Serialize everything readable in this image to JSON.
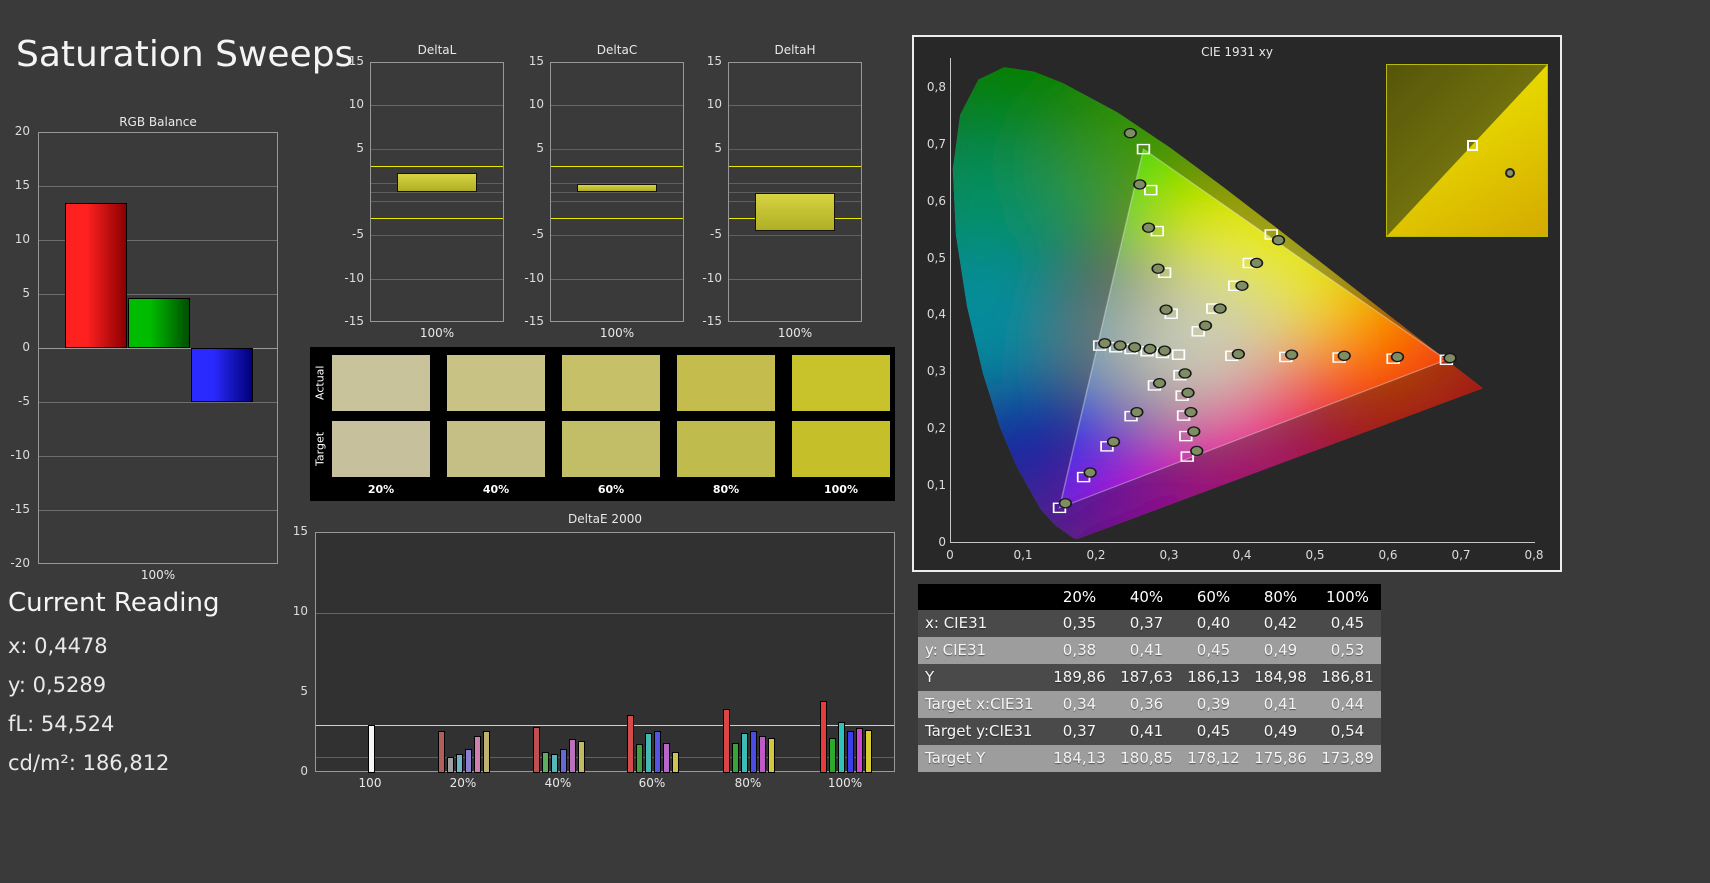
{
  "page": {
    "title": "Saturation Sweeps"
  },
  "current_reading": {
    "heading": "Current Reading",
    "lines": [
      "x: 0,4478",
      "y: 0,5289",
      "fL: 54,524",
      "cd/m²: 186,812"
    ]
  },
  "swatches": {
    "row_labels": [
      "Actual",
      "Target"
    ],
    "col_labels": [
      "20%",
      "40%",
      "60%",
      "80%",
      "100%"
    ],
    "actual_colors": [
      "#c9c39c",
      "#c8c384",
      "#c6c069",
      "#c4bd4d",
      "#c8c22b"
    ],
    "target_colors": [
      "#c6c09d",
      "#c5bf85",
      "#c2be68",
      "#c0bb4d",
      "#c5bf2a"
    ]
  },
  "table": {
    "headers": [
      "",
      "20%",
      "40%",
      "60%",
      "80%",
      "100%"
    ],
    "rows": [
      {
        "label": "x: CIE31",
        "values": [
          "0,35",
          "0,37",
          "0,40",
          "0,42",
          "0,45"
        ]
      },
      {
        "label": "y: CIE31",
        "values": [
          "0,38",
          "0,41",
          "0,45",
          "0,49",
          "0,53"
        ]
      },
      {
        "label": "Y",
        "values": [
          "189,86",
          "187,63",
          "186,13",
          "184,98",
          "186,81"
        ]
      },
      {
        "label": "Target x:CIE31",
        "values": [
          "0,34",
          "0,36",
          "0,39",
          "0,41",
          "0,44"
        ]
      },
      {
        "label": "Target y:CIE31",
        "values": [
          "0,37",
          "0,41",
          "0,45",
          "0,49",
          "0,54"
        ]
      },
      {
        "label": "Target Y",
        "values": [
          "184,13",
          "180,85",
          "178,12",
          "175,86",
          "173,89"
        ]
      }
    ]
  },
  "chart_data": [
    {
      "id": "rgb_balance",
      "type": "bar",
      "title": "RGB Balance",
      "xlabel": "100%",
      "ylim": [
        -20,
        20
      ],
      "yticks": [
        20,
        15,
        10,
        5,
        0,
        -5,
        -10,
        -15,
        -20
      ],
      "categories": [
        "red",
        "green",
        "blue"
      ],
      "values": [
        13.4,
        4.6,
        -5.0
      ],
      "bar_colors": [
        [
          "#ff2020",
          "#8a0000"
        ],
        [
          "#00bc00",
          "#004f00"
        ],
        [
          "#2a2aff",
          "#000078"
        ]
      ]
    },
    {
      "id": "delta_l",
      "type": "bar",
      "title": "DeltaL",
      "xlabel": "100%",
      "ylim": [
        -15,
        15
      ],
      "yticks": [
        15,
        10,
        5,
        -5,
        -10,
        -15
      ],
      "value": 2.2,
      "bar_color": "#c9c733",
      "limit_lines": [
        {
          "value": 10,
          "color": "#e03434"
        },
        {
          "value": -10,
          "color": "#e03434"
        },
        {
          "value": 3,
          "color": "#eaea00"
        },
        {
          "value": -3,
          "color": "#eaea00"
        },
        {
          "value": 1,
          "color": "#00a400"
        },
        {
          "value": -1,
          "color": "#00a400"
        }
      ]
    },
    {
      "id": "delta_c",
      "type": "bar",
      "title": "DeltaC",
      "xlabel": "100%",
      "ylim": [
        -15,
        15
      ],
      "yticks": [
        15,
        10,
        5,
        -5,
        -10,
        -15
      ],
      "value": 0.9,
      "bar_color": "#c9c733",
      "limit_lines": [
        {
          "value": 10,
          "color": "#e03434"
        },
        {
          "value": -10,
          "color": "#e03434"
        },
        {
          "value": 3,
          "color": "#eaea00"
        },
        {
          "value": -3,
          "color": "#eaea00"
        },
        {
          "value": 1,
          "color": "#00a400"
        },
        {
          "value": -1,
          "color": "#00a400"
        }
      ]
    },
    {
      "id": "delta_h",
      "type": "bar",
      "title": "DeltaH",
      "xlabel": "100%",
      "ylim": [
        -15,
        15
      ],
      "yticks": [
        15,
        10,
        5,
        -5,
        -10,
        -15
      ],
      "value": -4.4,
      "bar_color": "#c9c733",
      "limit_lines": [
        {
          "value": 10,
          "color": "#e03434"
        },
        {
          "value": -10,
          "color": "#e03434"
        },
        {
          "value": 3,
          "color": "#eaea00"
        },
        {
          "value": -3,
          "color": "#eaea00"
        },
        {
          "value": 1,
          "color": "#00a400"
        },
        {
          "value": -1,
          "color": "#00a400"
        }
      ]
    },
    {
      "id": "delta_e_2000",
      "type": "bar",
      "title": "DeltaE 2000",
      "ylim": [
        0,
        15
      ],
      "yticks": [
        15,
        10,
        5,
        0
      ],
      "limit_lines": [
        {
          "value": 10,
          "color": "#e03434"
        },
        {
          "value": 3,
          "color": "#eaea00"
        },
        {
          "value": 1,
          "color": "#00a400"
        }
      ],
      "groups": [
        {
          "label": "100",
          "bars": [
            {
              "color": "#f5f5f5",
              "value": 3.0
            }
          ]
        },
        {
          "label": "20%",
          "bars": [
            {
              "color": "#b35d5d",
              "value": 2.6
            },
            {
              "color": "#a0a0a0",
              "value": 1.0
            },
            {
              "color": "#6fb3c9",
              "value": 1.2
            },
            {
              "color": "#8d7ed2",
              "value": 1.5
            },
            {
              "color": "#d17fae",
              "value": 2.3
            },
            {
              "color": "#bfb172",
              "value": 2.6
            }
          ]
        },
        {
          "label": "40%",
          "bars": [
            {
              "color": "#c24f4f",
              "value": 2.9
            },
            {
              "color": "#5fae5f",
              "value": 1.3
            },
            {
              "color": "#55b7b7",
              "value": 1.2
            },
            {
              "color": "#6767da",
              "value": 1.5
            },
            {
              "color": "#bc6fbc",
              "value": 2.1
            },
            {
              "color": "#c3b964",
              "value": 2.0
            }
          ]
        },
        {
          "label": "60%",
          "bars": [
            {
              "color": "#d44a4a",
              "value": 3.6
            },
            {
              "color": "#3fa03f",
              "value": 1.8
            },
            {
              "color": "#43b7b0",
              "value": 2.5
            },
            {
              "color": "#5555e2",
              "value": 2.6
            },
            {
              "color": "#b765ca",
              "value": 1.9
            },
            {
              "color": "#cdc34e",
              "value": 1.3
            }
          ]
        },
        {
          "label": "80%",
          "bars": [
            {
              "color": "#dc4545",
              "value": 4.0
            },
            {
              "color": "#37a437",
              "value": 1.9
            },
            {
              "color": "#3cbcb4",
              "value": 2.5
            },
            {
              "color": "#4b4be6",
              "value": 2.6
            },
            {
              "color": "#c159c9",
              "value": 2.3
            },
            {
              "color": "#d2c83e",
              "value": 2.2
            }
          ]
        },
        {
          "label": "100%",
          "bars": [
            {
              "color": "#e63c3c",
              "value": 4.5
            },
            {
              "color": "#2caa2c",
              "value": 2.2
            },
            {
              "color": "#2fc4bb",
              "value": 3.2
            },
            {
              "color": "#3d3dee",
              "value": 2.6
            },
            {
              "color": "#cc46d2",
              "value": 2.8
            },
            {
              "color": "#d8cc30",
              "value": 2.7
            }
          ]
        }
      ]
    },
    {
      "id": "cie",
      "type": "scatter",
      "title": "CIE 1931 xy",
      "xlim": [
        0,
        0.8
      ],
      "ylim": [
        0,
        0.85
      ],
      "xticks": [
        "0",
        "0,1",
        "0,2",
        "0,3",
        "0,4",
        "0,5",
        "0,6",
        "0,7",
        "0,8"
      ],
      "yticks": [
        "0",
        "0,1",
        "0,2",
        "0,3",
        "0,4",
        "0,5",
        "0,6",
        "0,7",
        "0,8"
      ],
      "gamut_triangle": [
        [
          0.68,
          0.32
        ],
        [
          0.265,
          0.69
        ],
        [
          0.15,
          0.06
        ]
      ],
      "white_point": [
        0.313,
        0.329
      ],
      "inset_square": [
        0.5,
        0.44
      ],
      "inset_circle": [
        0.74,
        0.6
      ],
      "series": [
        {
          "name": "red",
          "targets": [
            [
              0.386,
              0.327
            ],
            [
              0.46,
              0.325
            ],
            [
              0.533,
              0.324
            ],
            [
              0.607,
              0.322
            ],
            [
              0.68,
              0.32
            ]
          ],
          "measured": [
            [
              0.395,
              0.33
            ],
            [
              0.468,
              0.329
            ],
            [
              0.54,
              0.327
            ],
            [
              0.613,
              0.325
            ],
            [
              0.685,
              0.323
            ]
          ]
        },
        {
          "name": "green",
          "targets": [
            [
              0.303,
              0.401
            ],
            [
              0.294,
              0.473
            ],
            [
              0.284,
              0.546
            ],
            [
              0.275,
              0.618
            ],
            [
              0.265,
              0.69
            ]
          ],
          "measured": [
            [
              0.296,
              0.408
            ],
            [
              0.285,
              0.48
            ],
            [
              0.272,
              0.552
            ],
            [
              0.26,
              0.628
            ],
            [
              0.247,
              0.718
            ]
          ]
        },
        {
          "name": "blue",
          "targets": [
            [
              0.28,
              0.275
            ],
            [
              0.248,
              0.221
            ],
            [
              0.215,
              0.168
            ],
            [
              0.183,
              0.114
            ],
            [
              0.15,
              0.06
            ]
          ],
          "measured": [
            [
              0.287,
              0.279
            ],
            [
              0.256,
              0.228
            ],
            [
              0.224,
              0.176
            ],
            [
              0.192,
              0.122
            ],
            [
              0.158,
              0.068
            ]
          ]
        },
        {
          "name": "cyan",
          "targets": [
            [
              0.291,
              0.332
            ],
            [
              0.27,
              0.335
            ],
            [
              0.248,
              0.339
            ],
            [
              0.227,
              0.342
            ],
            [
              0.205,
              0.345
            ]
          ],
          "measured": [
            [
              0.294,
              0.336
            ],
            [
              0.274,
              0.339
            ],
            [
              0.253,
              0.342
            ],
            [
              0.233,
              0.345
            ],
            [
              0.212,
              0.349
            ]
          ]
        },
        {
          "name": "magenta",
          "targets": [
            [
              0.315,
              0.293
            ],
            [
              0.318,
              0.257
            ],
            [
              0.32,
              0.222
            ],
            [
              0.323,
              0.186
            ],
            [
              0.325,
              0.15
            ]
          ],
          "measured": [
            [
              0.322,
              0.296
            ],
            [
              0.326,
              0.262
            ],
            [
              0.33,
              0.228
            ],
            [
              0.334,
              0.194
            ],
            [
              0.338,
              0.16
            ]
          ]
        },
        {
          "name": "yellow",
          "targets": [
            [
              0.34,
              0.37
            ],
            [
              0.36,
              0.41
            ],
            [
              0.39,
              0.45
            ],
            [
              0.41,
              0.49
            ],
            [
              0.44,
              0.54
            ]
          ],
          "measured": [
            [
              0.35,
              0.38
            ],
            [
              0.37,
              0.41
            ],
            [
              0.4,
              0.45
            ],
            [
              0.42,
              0.49
            ],
            [
              0.45,
              0.53
            ]
          ]
        }
      ],
      "locus": [
        [
          0.1741,
          0.005
        ],
        [
          0.1714,
          0.0051
        ],
        [
          0.1644,
          0.0109
        ],
        [
          0.144,
          0.0297
        ],
        [
          0.1241,
          0.0578
        ],
        [
          0.0913,
          0.1327
        ],
        [
          0.0687,
          0.2007
        ],
        [
          0.0454,
          0.295
        ],
        [
          0.0235,
          0.4127
        ],
        [
          0.0082,
          0.5384
        ],
        [
          0.0039,
          0.6548
        ],
        [
          0.0139,
          0.7502
        ],
        [
          0.0389,
          0.812
        ],
        [
          0.0743,
          0.8338
        ],
        [
          0.1142,
          0.8262
        ],
        [
          0.1547,
          0.8059
        ],
        [
          0.2296,
          0.7543
        ],
        [
          0.3016,
          0.6923
        ],
        [
          0.3731,
          0.6245
        ],
        [
          0.4441,
          0.5547
        ],
        [
          0.5125,
          0.4866
        ],
        [
          0.5752,
          0.4242
        ],
        [
          0.627,
          0.3725
        ],
        [
          0.6658,
          0.334
        ],
        [
          0.6915,
          0.3083
        ],
        [
          0.7079,
          0.292
        ],
        [
          0.719,
          0.2809
        ],
        [
          0.726,
          0.274
        ],
        [
          0.73,
          0.27
        ]
      ]
    }
  ]
}
